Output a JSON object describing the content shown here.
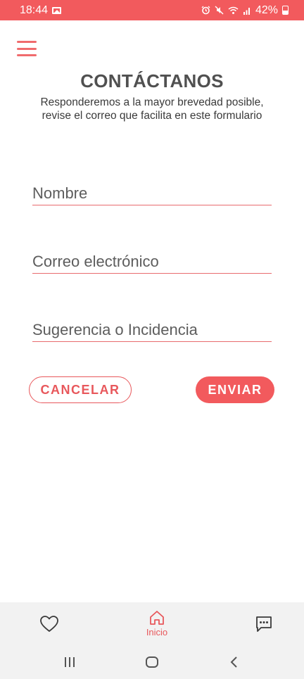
{
  "status_bar": {
    "time": "18:44",
    "battery": "42%",
    "icons": [
      "image-icon",
      "alarm-icon",
      "mute-icon",
      "wifi-icon",
      "signal-icon",
      "battery-icon"
    ]
  },
  "header": {
    "menu_icon": "hamburger-menu-icon",
    "title": "CONTÁCTANOS",
    "subtitle": "Responderemos a la mayor brevedad posible, revise el correo que facilita en este formulario"
  },
  "form": {
    "name": {
      "value": "",
      "placeholder": "Nombre"
    },
    "email": {
      "value": "",
      "placeholder": "Correo electrónico"
    },
    "message": {
      "value": "",
      "placeholder": "Sugerencia o Incidencia"
    },
    "cancel_label": "CANCELAR",
    "send_label": "ENVIAR"
  },
  "bottom_nav": {
    "items": [
      {
        "icon": "heart-icon",
        "label": ""
      },
      {
        "icon": "home-icon",
        "label": "Inicio",
        "active": true
      },
      {
        "icon": "chat-icon",
        "label": ""
      }
    ]
  },
  "system_nav": {
    "icons": [
      "recent-apps-icon",
      "home-circle-icon",
      "back-icon"
    ]
  },
  "colors": {
    "accent": "#f25a5d",
    "accent_dark": "#e8585c",
    "title": "#505050",
    "nav_bg": "#f2f2f2"
  }
}
